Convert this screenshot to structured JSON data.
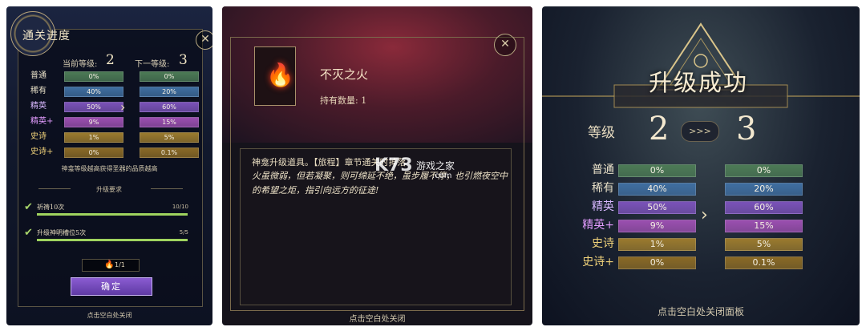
{
  "panel1": {
    "title": "通关进度",
    "current_label": "当前等级:",
    "current_value": "2",
    "next_label": "下一等级:",
    "next_value": "3",
    "close_icon": "x-icon",
    "rates": [
      {
        "name": "普通",
        "cur": "0%",
        "next": "0%",
        "color": "#4c7a55",
        "name_color": "#e8e0c8"
      },
      {
        "name": "稀有",
        "cur": "40%",
        "next": "20%",
        "color": "#3f6ea0",
        "name_color": "#e8e0c8"
      },
      {
        "name": "精英",
        "cur": "50%",
        "next": "60%",
        "color": "#7a52b8",
        "name_color": "#d8b8ff"
      },
      {
        "name": "精英+",
        "cur": "9%",
        "next": "15%",
        "color": "#9b4fb0",
        "name_color": "#e39cff"
      },
      {
        "name": "史诗",
        "cur": "1%",
        "next": "5%",
        "color": "#9a7a2e",
        "name_color": "#f0d27a"
      },
      {
        "name": "史诗+",
        "cur": "0%",
        "next": "0.1%",
        "color": "#8a6a26",
        "name_color": "#f0d27a"
      }
    ],
    "note": "神龛等级越高获得圣器的品质越高",
    "req_title": "升级要求",
    "requirements": [
      {
        "text": "祈祷10次",
        "count": "10/10",
        "progress": 1.0
      },
      {
        "text": "升级神明槽位5次",
        "count": "5/5",
        "progress": 1.0
      }
    ],
    "cost_icon": "flame-icon",
    "cost": "1/1",
    "confirm": "确定",
    "close_hint": "点击空白处关闭"
  },
  "panel2": {
    "close_icon": "x-icon",
    "item_icon": "flame-icon",
    "item_name": "不灭之火",
    "item_qty": "持有数量: 1",
    "desc_line1": "神龛升级道具。【旅程】章节通关时掉落",
    "desc_line2": "火虽微弱，但若凝聚，则可绵延不绝，虽步履不停，也引燃夜空中的希望之炬，指引向远方的征途!",
    "watermark": "K73",
    "watermark_site": "游戏之家",
    "watermark_url": ".com",
    "close_hint": "点击空白处关闭"
  },
  "panel3": {
    "title": "升级成功",
    "level_label": "等级",
    "from_level": "2",
    "to_level": "3",
    "level_arrow": ">>>",
    "rates": [
      {
        "name": "普通",
        "cur": "0%",
        "next": "0%",
        "color": "#4c7a55",
        "name_color": "#e8e0c8"
      },
      {
        "name": "稀有",
        "cur": "40%",
        "next": "20%",
        "color": "#3f6ea0",
        "name_color": "#e8e0c8"
      },
      {
        "name": "精英",
        "cur": "50%",
        "next": "60%",
        "color": "#7a52b8",
        "name_color": "#d8b8ff"
      },
      {
        "name": "精英+",
        "cur": "9%",
        "next": "15%",
        "color": "#9b4fb0",
        "name_color": "#e39cff"
      },
      {
        "name": "史诗",
        "cur": "1%",
        "next": "5%",
        "color": "#9a7a2e",
        "name_color": "#f0d27a"
      },
      {
        "name": "史诗+",
        "cur": "0%",
        "next": "0.1%",
        "color": "#8a6a26",
        "name_color": "#f0d27a"
      }
    ],
    "close_hint": "点击空白处关闭面板"
  }
}
